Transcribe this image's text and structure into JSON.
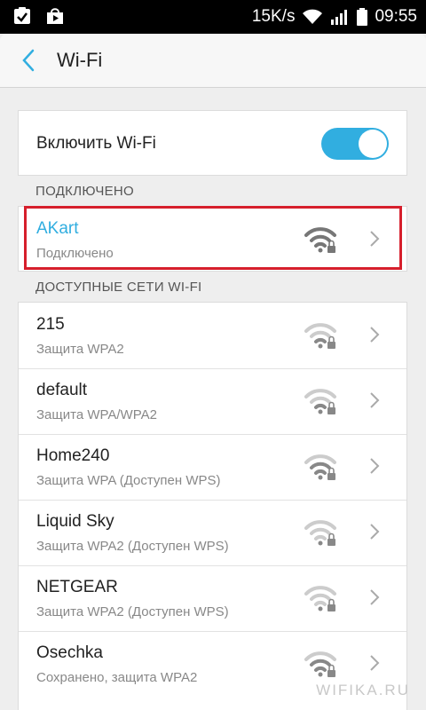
{
  "status_bar": {
    "speed": "15K/s",
    "time": "09:55",
    "icons": [
      "clipboard-check-icon",
      "play-store-icon",
      "wifi-icon",
      "signal-icon",
      "battery-icon"
    ]
  },
  "header": {
    "title": "Wi-Fi",
    "back_icon": "chevron-left-icon"
  },
  "toggle": {
    "label": "Включить Wi-Fi",
    "state": "on",
    "accent": "#31aee0"
  },
  "connected": {
    "header": "ПОДКЛЮЧЕНО",
    "network": {
      "name": "AKart",
      "status": "Подключено"
    }
  },
  "available": {
    "header": "ДОСТУПНЫЕ СЕТИ WI-FI",
    "networks": [
      {
        "name": "215",
        "status": "Защита WPA2"
      },
      {
        "name": "default",
        "status": "Защита WPA/WPA2"
      },
      {
        "name": "Home240",
        "status": "Защита WPA (Доступен WPS)"
      },
      {
        "name": "Liquid Sky",
        "status": "Защита WPA2 (Доступен WPS)"
      },
      {
        "name": "NETGEAR",
        "status": "Защита WPA2 (Доступен WPS)"
      },
      {
        "name": "Osechka",
        "status": "Сохранено, защита WPA2"
      }
    ]
  },
  "watermark": "WIFIKA.RU",
  "colors": {
    "accent": "#31aee0",
    "highlight": "#d61f2c",
    "background": "#eeeeee"
  }
}
